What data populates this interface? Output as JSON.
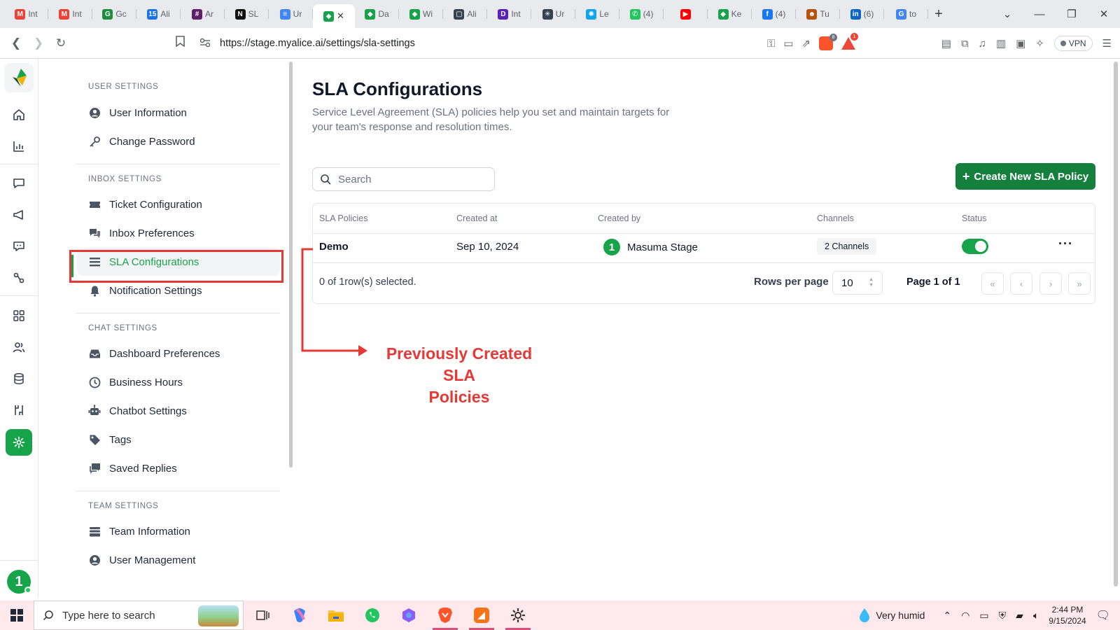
{
  "browser": {
    "tabs": [
      {
        "title": "Int",
        "icon": "gmail-icon",
        "color": "#ea4335",
        "glyph": "M"
      },
      {
        "title": "Int",
        "icon": "gmail-icon",
        "color": "#ea4335",
        "glyph": "M"
      },
      {
        "title": "Gc",
        "icon": "google-classroom-icon",
        "color": "#1e8e3e",
        "glyph": "G"
      },
      {
        "title": "Ali",
        "icon": "calendar-icon",
        "color": "#1a73e8",
        "glyph": "15"
      },
      {
        "title": "Ar",
        "icon": "slack-icon",
        "color": "#611f69",
        "glyph": "#"
      },
      {
        "title": "SL",
        "icon": "notion-icon",
        "color": "#111111",
        "glyph": "N"
      },
      {
        "title": "Ur",
        "icon": "google-docs-icon",
        "color": "#4285f4",
        "glyph": "≡"
      },
      {
        "title": "",
        "icon": "myalice-icon",
        "color": "#16a34a",
        "glyph": "◆",
        "active": true
      },
      {
        "title": "Da",
        "icon": "myalice-icon",
        "color": "#16a34a",
        "glyph": "◆"
      },
      {
        "title": "Wi",
        "icon": "myalice-icon",
        "color": "#16a34a",
        "glyph": "◆"
      },
      {
        "title": "Ali",
        "icon": "tab-window-icon",
        "color": "#374151",
        "glyph": "▢"
      },
      {
        "title": "Int",
        "icon": "dtwo-icon",
        "color": "#5b21b6",
        "glyph": "D"
      },
      {
        "title": "Ur",
        "icon": "chatgpt-icon",
        "color": "#374151",
        "glyph": "✳"
      },
      {
        "title": "Le",
        "icon": "globe-icon",
        "color": "#0ea5e9",
        "glyph": "✺"
      },
      {
        "title": "(4)",
        "icon": "whatsapp-icon",
        "color": "#22c55e",
        "glyph": "✆"
      },
      {
        "title": "",
        "icon": "youtube-icon",
        "color": "#ff0000",
        "glyph": "▶"
      },
      {
        "title": "Ke",
        "icon": "myalice-icon",
        "color": "#16a34a",
        "glyph": "◆"
      },
      {
        "title": "(4)",
        "icon": "facebook-icon",
        "color": "#1877f2",
        "glyph": "f"
      },
      {
        "title": "Tu",
        "icon": "cowboy-icon",
        "color": "#b45309",
        "glyph": "☻"
      },
      {
        "title": "(6)",
        "icon": "linkedin-icon",
        "color": "#0a66c2",
        "glyph": "in"
      },
      {
        "title": "to",
        "icon": "google-icon",
        "color": "#4285f4",
        "glyph": "G"
      }
    ],
    "url": "https://stage.myalice.ai/settings/sla-settings",
    "brave_badge": "8",
    "rewards_badge": "1",
    "vpn_label": "VPN"
  },
  "settings_nav": {
    "sections": [
      {
        "title": "USER SETTINGS",
        "items": [
          {
            "label": "User Information",
            "icon": "user-circle-icon"
          },
          {
            "label": "Change Password",
            "icon": "key-icon"
          }
        ]
      },
      {
        "title": "INBOX SETTINGS",
        "items": [
          {
            "label": "Ticket Configuration",
            "icon": "ticket-icon"
          },
          {
            "label": "Inbox Preferences",
            "icon": "chat-bubbles-icon"
          },
          {
            "label": "SLA Configurations",
            "icon": "list-icon",
            "active": true
          },
          {
            "label": "Notification Settings",
            "icon": "bell-icon"
          }
        ]
      },
      {
        "title": "CHAT SETTINGS",
        "items": [
          {
            "label": "Dashboard Preferences",
            "icon": "inbox-tray-icon"
          },
          {
            "label": "Business Hours",
            "icon": "clock-icon"
          },
          {
            "label": "Chatbot Settings",
            "icon": "robot-icon"
          },
          {
            "label": "Tags",
            "icon": "tag-icon"
          },
          {
            "label": "Saved Replies",
            "icon": "saved-replies-icon"
          }
        ]
      },
      {
        "title": "TEAM SETTINGS",
        "items": [
          {
            "label": "Team Information",
            "icon": "team-icon"
          },
          {
            "label": "User Management",
            "icon": "user-circle-icon"
          }
        ]
      }
    ]
  },
  "main": {
    "title": "SLA Configurations",
    "description": "Service Level Agreement (SLA) policies help you set and maintain targets for your team's response and resolution times.",
    "search_placeholder": "Search",
    "create_button": "Create New SLA Policy",
    "table": {
      "columns": [
        "SLA Policies",
        "Created at",
        "Created by",
        "Channels",
        "Status"
      ],
      "rows": [
        {
          "policy": "Demo",
          "created_at": "Sep 10, 2024",
          "creator_initial": "1",
          "created_by": "Masuma Stage",
          "channels": "2 Channels",
          "status_on": true
        }
      ],
      "selection_text": "0 of 1row(s) selected.",
      "rows_per_page_label": "Rows per page",
      "rows_per_page_value": "10",
      "page_text": "Page 1 of 1"
    }
  },
  "annotation": {
    "text_line1": "Previously Created SLA",
    "text_line2": "Policies",
    "color": "#e53935"
  },
  "rail": {
    "avatar_initial": "1",
    "accent": "#16a34a"
  },
  "taskbar": {
    "search_placeholder": "Type here to search",
    "weather": "Very humid",
    "time": "2:44 PM",
    "date": "9/15/2024"
  }
}
